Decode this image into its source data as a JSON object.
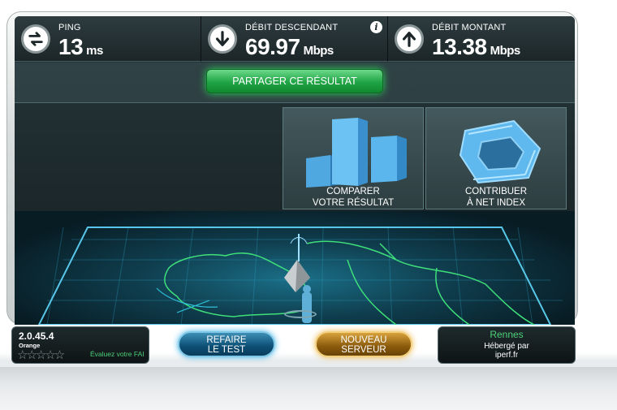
{
  "stats": {
    "ping": {
      "label": "PING",
      "value": "13",
      "unit": "ms",
      "icon": "swap-arrows-icon"
    },
    "download": {
      "label": "DÉBIT DESCENDANT",
      "value": "69.97",
      "unit": "Mbps",
      "icon": "arrow-down-icon"
    },
    "upload": {
      "label": "DÉBIT MONTANT",
      "value": "13.38",
      "unit": "Mbps",
      "icon": "arrow-up-icon"
    },
    "info_label": "i"
  },
  "share": {
    "label": "PARTAGER CE RÉSULTAT"
  },
  "tiles": {
    "compare": {
      "line1": "COMPARER",
      "line2": "VOTRE RÉSULTAT",
      "icon": "bar-chart-icon"
    },
    "contribute": {
      "line1": "CONTRIBUER",
      "line2": "À NET INDEX",
      "icon": "net-index-icon"
    }
  },
  "footer": {
    "version": "2.0.45.4",
    "isp": "Orange",
    "rating_stars": "☆☆☆☆☆",
    "rating_label": "Évaluez votre FAI",
    "redo_line1": "REFAIRE",
    "redo_line2": "LE TEST",
    "server_line1": "NOUVEAU",
    "server_line2": "SERVEUR",
    "city": "Rennes",
    "host_line1": "Hébergé par",
    "host_line2": "iperf.fr"
  },
  "colors": {
    "share_green": "#1fa445",
    "redo_blue": "#0d4e74",
    "server_gold": "#8a5a0c",
    "city_green": "#4cd07a"
  }
}
